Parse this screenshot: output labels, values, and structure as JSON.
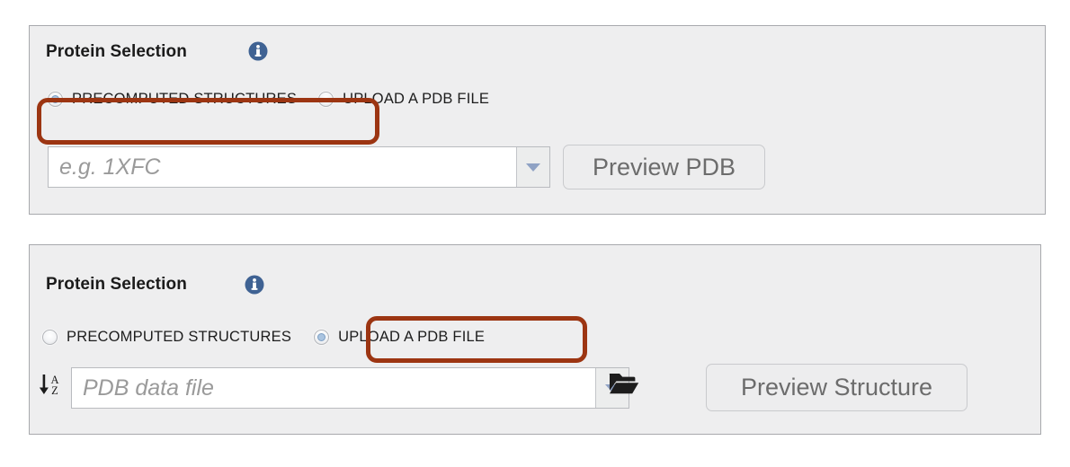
{
  "panels": [
    {
      "title": "Protein Selection",
      "info_icon": "info-icon",
      "options": [
        {
          "label": "PRECOMPUTED STRUCTURES",
          "selected": true
        },
        {
          "label": "UPLOAD A PDB FILE",
          "selected": false
        }
      ],
      "highlighted_option": "PRECOMPUTED STRUCTURES",
      "input": {
        "placeholder": "e.g. 1XFC",
        "value": "",
        "dropdown_icon": "chevron-down-icon"
      },
      "button": "Preview PDB"
    },
    {
      "title": "Protein Selection",
      "info_icon": "info-icon",
      "options": [
        {
          "label": "PRECOMPUTED STRUCTURES",
          "selected": false
        },
        {
          "label": "UPLOAD A PDB FILE",
          "selected": true
        }
      ],
      "highlighted_option": "UPLOAD A PDB FILE",
      "sort_icon": "sort-az-icon",
      "input": {
        "placeholder": "PDB data file",
        "value": "",
        "dropdown_icon": "chevron-down-icon"
      },
      "browse_icon": "open-folder-icon",
      "button": "Preview Structure"
    }
  ],
  "colors": {
    "highlight": "#9c3512",
    "panel_background": "#eeeeef",
    "panel_border": "#a8a9ad",
    "info_icon": "#3f6293",
    "radio_dot": "#aac4e0",
    "placeholder_text": "#9a9a9a",
    "button_text": "#6c6c6c"
  }
}
